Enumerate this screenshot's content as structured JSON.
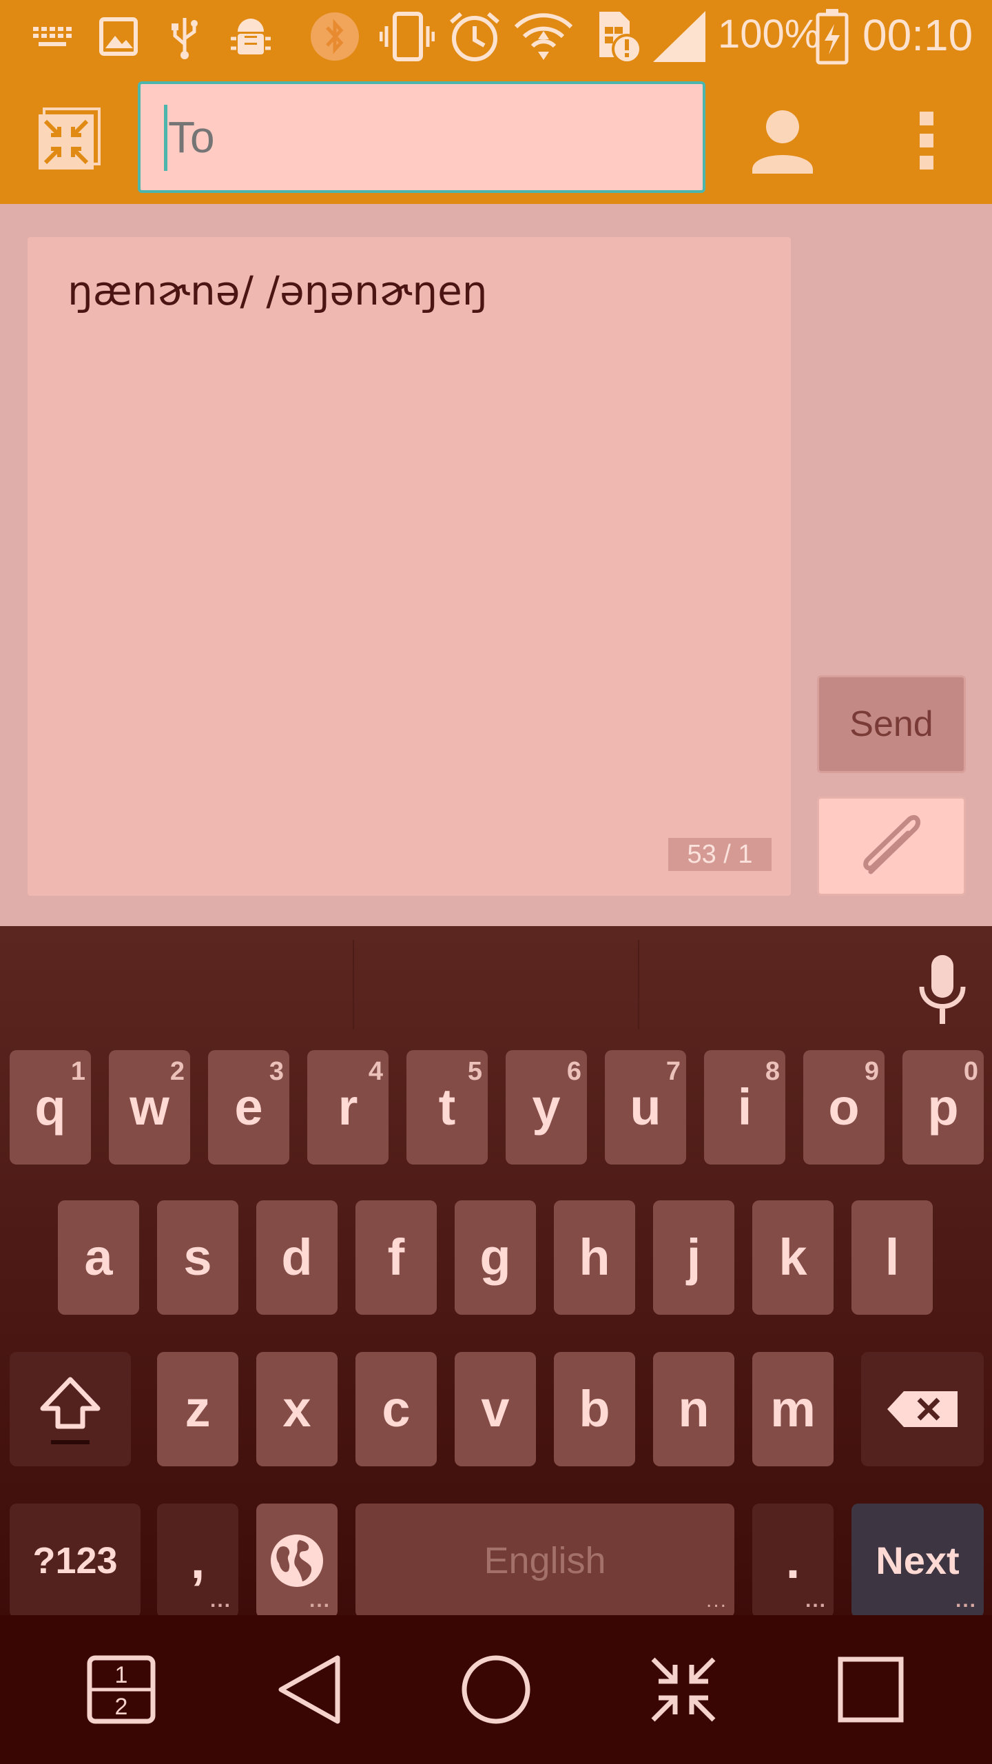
{
  "status_bar": {
    "battery_percent": "100%",
    "time": "00:10",
    "icons": [
      "keyboard-icon",
      "image-icon",
      "usb-icon",
      "android-debug-icon",
      "bluetooth-icon",
      "vibrate-icon",
      "alarm-icon",
      "wifi-icon",
      "sim-alert-icon",
      "signal-icon",
      "battery-charging-icon"
    ]
  },
  "toolbar": {
    "to_placeholder": "To",
    "collapse_icon": "collapse-icon",
    "contact_icon": "person-icon",
    "menu_icon": "overflow-menu-icon"
  },
  "compose": {
    "message_text": "ŋænɚnə/ /əŋənɚŋeŋ",
    "char_counter": "53 / 1",
    "send_label": "Send",
    "attach_icon": "paperclip-icon"
  },
  "keyboard": {
    "row1": [
      {
        "label": "q",
        "hint": "1"
      },
      {
        "label": "w",
        "hint": "2"
      },
      {
        "label": "e",
        "hint": "3"
      },
      {
        "label": "r",
        "hint": "4"
      },
      {
        "label": "t",
        "hint": "5"
      },
      {
        "label": "y",
        "hint": "6"
      },
      {
        "label": "u",
        "hint": "7"
      },
      {
        "label": "i",
        "hint": "8"
      },
      {
        "label": "o",
        "hint": "9"
      },
      {
        "label": "p",
        "hint": "0"
      }
    ],
    "row2": [
      "a",
      "s",
      "d",
      "f",
      "g",
      "h",
      "j",
      "k",
      "l"
    ],
    "row3": [
      "z",
      "x",
      "c",
      "v",
      "b",
      "n",
      "m"
    ],
    "symbols_label": "?123",
    "comma_label": ",",
    "space_label": "English",
    "period_label": ".",
    "next_label": "Next",
    "more_dots": "...",
    "icons": {
      "shift": "shift-icon",
      "backspace": "backspace-icon",
      "globe": "globe-icon",
      "mic": "microphone-icon"
    }
  },
  "nav_bar": {
    "split_top": "1",
    "split_bottom": "2",
    "icons": [
      "split-screen-icon",
      "back-icon",
      "home-icon",
      "collapse-icon",
      "recents-icon"
    ]
  },
  "colors": {
    "accent": "#e08a14",
    "compose_bg": "#dfaeaa",
    "field_bg": "#ffcbc3",
    "focus_border": "#4db6ac",
    "key_bg": "#834c47",
    "keyboard_bg": "#5c2620"
  }
}
